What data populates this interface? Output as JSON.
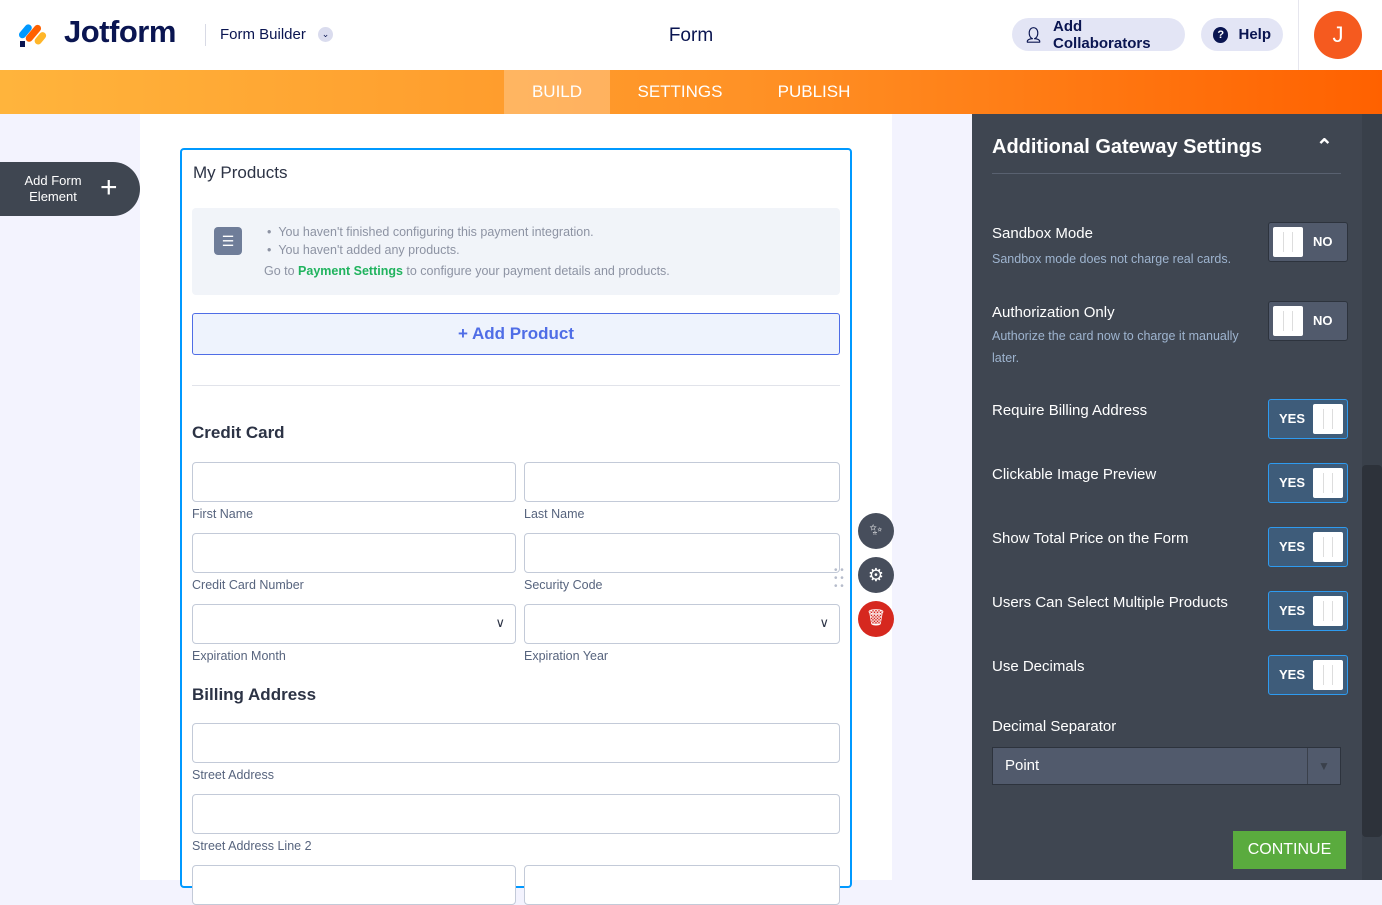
{
  "header": {
    "brand": "Jotform",
    "app_switch": "Form Builder",
    "title": "Form",
    "collab": "Add Collaborators",
    "help": "Help",
    "avatar": "J"
  },
  "tabs": [
    "BUILD",
    "SETTINGS",
    "PUBLISH"
  ],
  "sidebar": {
    "add_element": "Add Form Element"
  },
  "form": {
    "product_title": "My Products",
    "notices": [
      "You haven't finished configuring this payment integration.",
      "You haven't added any products."
    ],
    "goto_pre": "Go to ",
    "goto_link": "Payment Settings",
    "goto_post": " to configure your payment details and products.",
    "add_product": "+ Add Product",
    "credit_card": "Credit Card",
    "cc_fields": [
      "First Name",
      "Last Name",
      "Credit Card Number",
      "Security Code",
      "Expiration Month",
      "Expiration Year"
    ],
    "billing": "Billing Address",
    "billing_fields": [
      "Street Address",
      "Street Address Line 2"
    ]
  },
  "panel": {
    "title": "Additional Gateway Settings",
    "settings": [
      {
        "label": "Sandbox Mode",
        "sub": "Sandbox mode does not charge real cards.",
        "value": "NO"
      },
      {
        "label": "Authorization Only",
        "sub": "Authorize the card now to charge it manually later.",
        "value": "NO"
      },
      {
        "label": "Require Billing Address",
        "value": "YES"
      },
      {
        "label": "Clickable Image Preview",
        "value": "YES"
      },
      {
        "label": "Show Total Price on the Form",
        "value": "YES"
      },
      {
        "label": "Users Can Select Multiple Products",
        "value": "YES"
      },
      {
        "label": "Use Decimals",
        "value": "YES"
      }
    ],
    "decimal_label": "Decimal Separator",
    "decimal_value": "Point",
    "continue": "CONTINUE"
  },
  "colors": {
    "accent": "#ff6100",
    "panel": "#3f4651",
    "continue": "#5aab3e",
    "form_border": "#0099ff"
  }
}
